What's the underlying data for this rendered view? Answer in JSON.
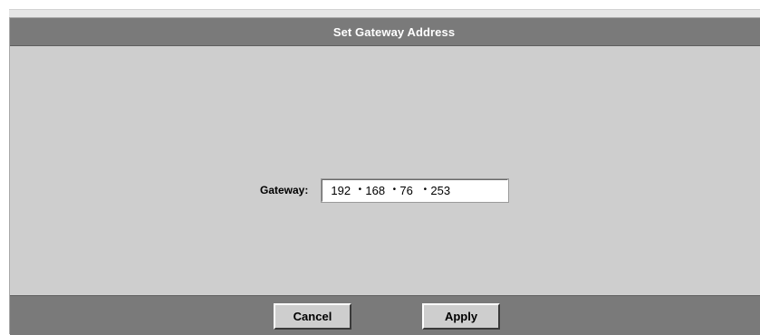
{
  "dialog": {
    "title": "Set Gateway Address"
  },
  "form": {
    "gateway_label": "Gateway:",
    "gateway_octets": [
      "192",
      "168",
      "76",
      "253"
    ],
    "separator": "•"
  },
  "footer": {
    "cancel_label": "Cancel",
    "apply_label": "Apply"
  },
  "colors": {
    "titlebar_bg": "#7a7a7a",
    "panel_bg": "#cecece",
    "title_text": "#ffffff"
  }
}
